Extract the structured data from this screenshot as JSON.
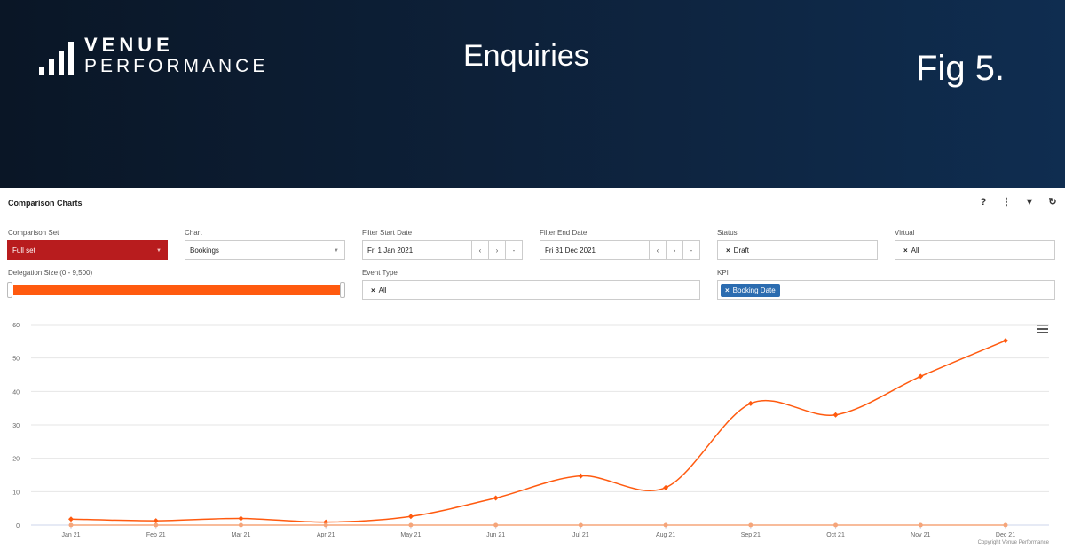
{
  "banner": {
    "logo_line1": "VENUE",
    "logo_line2": "PERFORMANCE",
    "title": "Enquiries",
    "figure": "Fig 5."
  },
  "panel": {
    "title": "Comparison Charts",
    "tools": {
      "help": "?",
      "more": "⋮",
      "filter": "▼",
      "refresh": "↻"
    }
  },
  "filters": {
    "comparison_set": {
      "label": "Comparison Set",
      "value": "Full set"
    },
    "chart": {
      "label": "Chart",
      "value": "Bookings"
    },
    "start_date": {
      "label": "Filter Start Date",
      "value": "Fri 1 Jan 2021"
    },
    "end_date": {
      "label": "Filter End Date",
      "value": "Fri 31 Dec 2021"
    },
    "status": {
      "label": "Status",
      "value": "Draft"
    },
    "virtual": {
      "label": "Virtual",
      "value": "All"
    },
    "delegation": {
      "label": "Delegation Size (0 - 9,500)",
      "min": 0,
      "max": 9500,
      "from": 0,
      "to": 9500
    },
    "event_type": {
      "label": "Event Type",
      "value": "All"
    },
    "kpi": {
      "label": "KPI",
      "value": "Booking Date"
    },
    "nav": {
      "prev": "‹",
      "next": "›",
      "clear": "-"
    },
    "remove": "×"
  },
  "colors": {
    "accent": "#ff5a0f",
    "baseline": "#f5a57a",
    "red": "#b81c1e",
    "blue": "#2b6cb0",
    "banner": "#0d2038"
  },
  "chart_data": {
    "type": "line",
    "categories": [
      "Jan 21",
      "Feb 21",
      "Mar 21",
      "Apr 21",
      "May 21",
      "Jun 21",
      "Jul 21",
      "Aug 21",
      "Sep 21",
      "Oct 21",
      "Nov 21",
      "Dec 21"
    ],
    "series": [
      {
        "values": [
          1.8,
          1.3,
          2.0,
          0.9,
          2.6,
          8.1,
          14.7,
          11.2,
          36.4,
          33.0,
          44.5,
          55.2
        ]
      },
      {
        "values": [
          0,
          0,
          0,
          0,
          0,
          0,
          0,
          0,
          0,
          0,
          0,
          0
        ]
      }
    ],
    "yticks": [
      0,
      10,
      20,
      30,
      40,
      50,
      60
    ],
    "ylim": [
      0,
      60
    ],
    "grid": true,
    "credit": "Copyright Venue Performance"
  }
}
